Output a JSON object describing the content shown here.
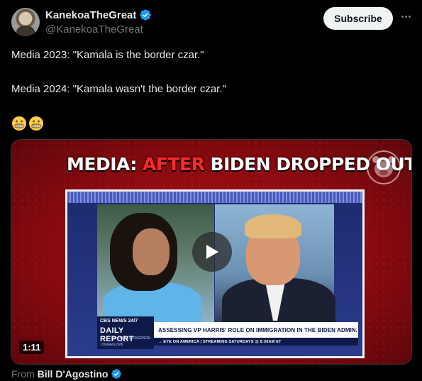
{
  "post": {
    "author_name": "KanekoaTheGreat",
    "author_handle": "@KanekoaTheGreat",
    "avatar_icon": "avatar-portrait",
    "verified_icon": "verified-badge-icon",
    "subscribe_label": "Subscribe",
    "more_icon": "more-options-icon",
    "line1": "Media 2023: \"Kamala is the border czar.\"",
    "line2": "Media 2024: \"Kamala wasn't the border czar.\"",
    "emojis": [
      "😬",
      "😬"
    ]
  },
  "media": {
    "headline_prefix": "MEDIA: ",
    "headline_accent": "AFTER",
    "headline_suffix": " BIDEN DROPPED OUT",
    "accent_color": "#ff2a2a",
    "play_icon": "play-icon",
    "duration": "1:11",
    "broadcast": {
      "network": "CBS NEWS 24/7",
      "show_title": "DAILY REPORT",
      "show_host": "with JOHN DICKERSON",
      "url": "cbsnews.com",
      "headline": "ASSESSING VP HARRIS' ROLE ON IMMIGRATION IN THE BIDEN ADMIN.",
      "ticker": "→ EYE ON AMERICA | STREAMING SATURDAYS @ 6:30AM ET"
    }
  },
  "attribution": {
    "from_label": "From",
    "from_name": "Bill D'Agostino"
  },
  "colors": {
    "background": "#000000",
    "text": "#e7e9ea",
    "muted": "#71767b",
    "verified": "#1d9bf0",
    "subscribe_bg": "#eff3f4"
  }
}
